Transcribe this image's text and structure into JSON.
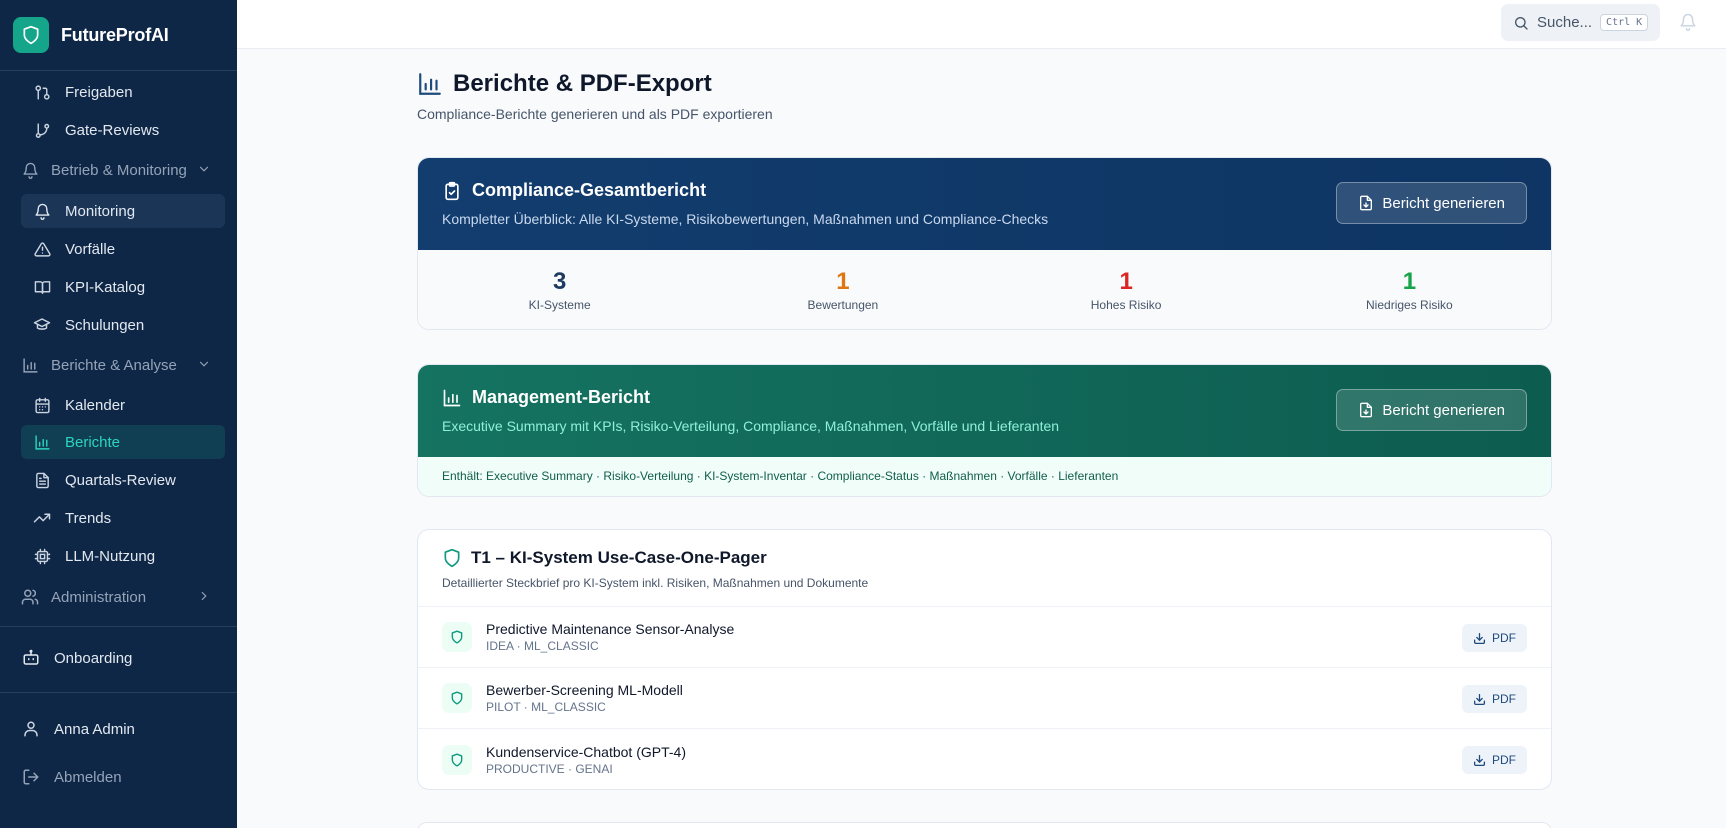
{
  "brand": {
    "name": "FutureProfAI"
  },
  "sidebar": {
    "items_top": [
      {
        "label": "Freigaben",
        "icon": "git-pull-request-icon"
      },
      {
        "label": "Gate-Reviews",
        "icon": "git-branch-icon"
      }
    ],
    "group_betrieb": {
      "label": "Betrieb & Monitoring",
      "icon": "bell-icon"
    },
    "items_betrieb": [
      {
        "label": "Monitoring",
        "icon": "bell-icon"
      },
      {
        "label": "Vorfälle",
        "icon": "alert-triangle-icon"
      },
      {
        "label": "KPI-Katalog",
        "icon": "book-icon"
      },
      {
        "label": "Schulungen",
        "icon": "graduation-cap-icon"
      }
    ],
    "group_berichte": {
      "label": "Berichte & Analyse",
      "icon": "bar-chart-icon"
    },
    "items_berichte": [
      {
        "label": "Kalender",
        "icon": "calendar-icon"
      },
      {
        "label": "Berichte",
        "icon": "bar-chart-icon"
      },
      {
        "label": "Quartals-Review",
        "icon": "file-text-icon"
      },
      {
        "label": "Trends",
        "icon": "trending-up-icon"
      },
      {
        "label": "LLM-Nutzung",
        "icon": "cpu-icon"
      }
    ],
    "group_admin": {
      "label": "Administration",
      "icon": "users-icon"
    },
    "onboarding": {
      "label": "Onboarding",
      "icon": "bot-icon"
    },
    "user": {
      "label": "Anna Admin",
      "icon": "user-icon"
    },
    "logout": {
      "label": "Abmelden",
      "icon": "log-out-icon"
    }
  },
  "topbar": {
    "search_placeholder": "Suche...",
    "shortcut": "Ctrl K"
  },
  "page": {
    "title": "Berichte & PDF-Export",
    "subtitle": "Compliance-Berichte generieren und als PDF exportieren"
  },
  "compliance_report": {
    "title": "Compliance-Gesamtbericht",
    "description": "Kompletter Überblick: Alle KI-Systeme, Risikobewertungen, Maßnahmen und Compliance-Checks",
    "button": "Bericht generieren",
    "stats": [
      {
        "value": "3",
        "label": "KI-Systeme",
        "color": "#1e3a5f"
      },
      {
        "value": "1",
        "label": "Bewertungen",
        "color": "#e07612"
      },
      {
        "value": "1",
        "label": "Hohes Risiko",
        "color": "#dc2626"
      },
      {
        "value": "1",
        "label": "Niedriges Risiko",
        "color": "#16a34a"
      }
    ]
  },
  "management_report": {
    "title": "Management-Bericht",
    "description": "Executive Summary mit KPIs, Risiko-Verteilung, Compliance, Maßnahmen, Vorfälle und Lieferanten",
    "button": "Bericht generieren",
    "contains": "Enthält: Executive Summary · Risiko-Verteilung · KI-System-Inventar · Compliance-Status · Maßnahmen · Vorfälle · Lieferanten"
  },
  "one_pager": {
    "title": "T1 – KI-System Use-Case-One-Pager",
    "description": "Detaillierter Steckbrief pro KI-System inkl. Risiken, Maßnahmen und Dokumente",
    "pdf_label": "PDF",
    "systems": [
      {
        "name": "Predictive Maintenance Sensor-Analyse",
        "meta": "IDEA · ML_CLASSIC"
      },
      {
        "name": "Bewerber-Screening ML-Modell",
        "meta": "PILOT · ML_CLASSIC"
      },
      {
        "name": "Kundenservice-Chatbot (GPT-4)",
        "meta": "PRODUCTIVE · GENAI"
      }
    ]
  },
  "colors": {
    "sidebar_bg": "#0f2746",
    "accent_teal": "#14a58b",
    "compliance_header": "#123d6e",
    "management_header": "#157361"
  }
}
